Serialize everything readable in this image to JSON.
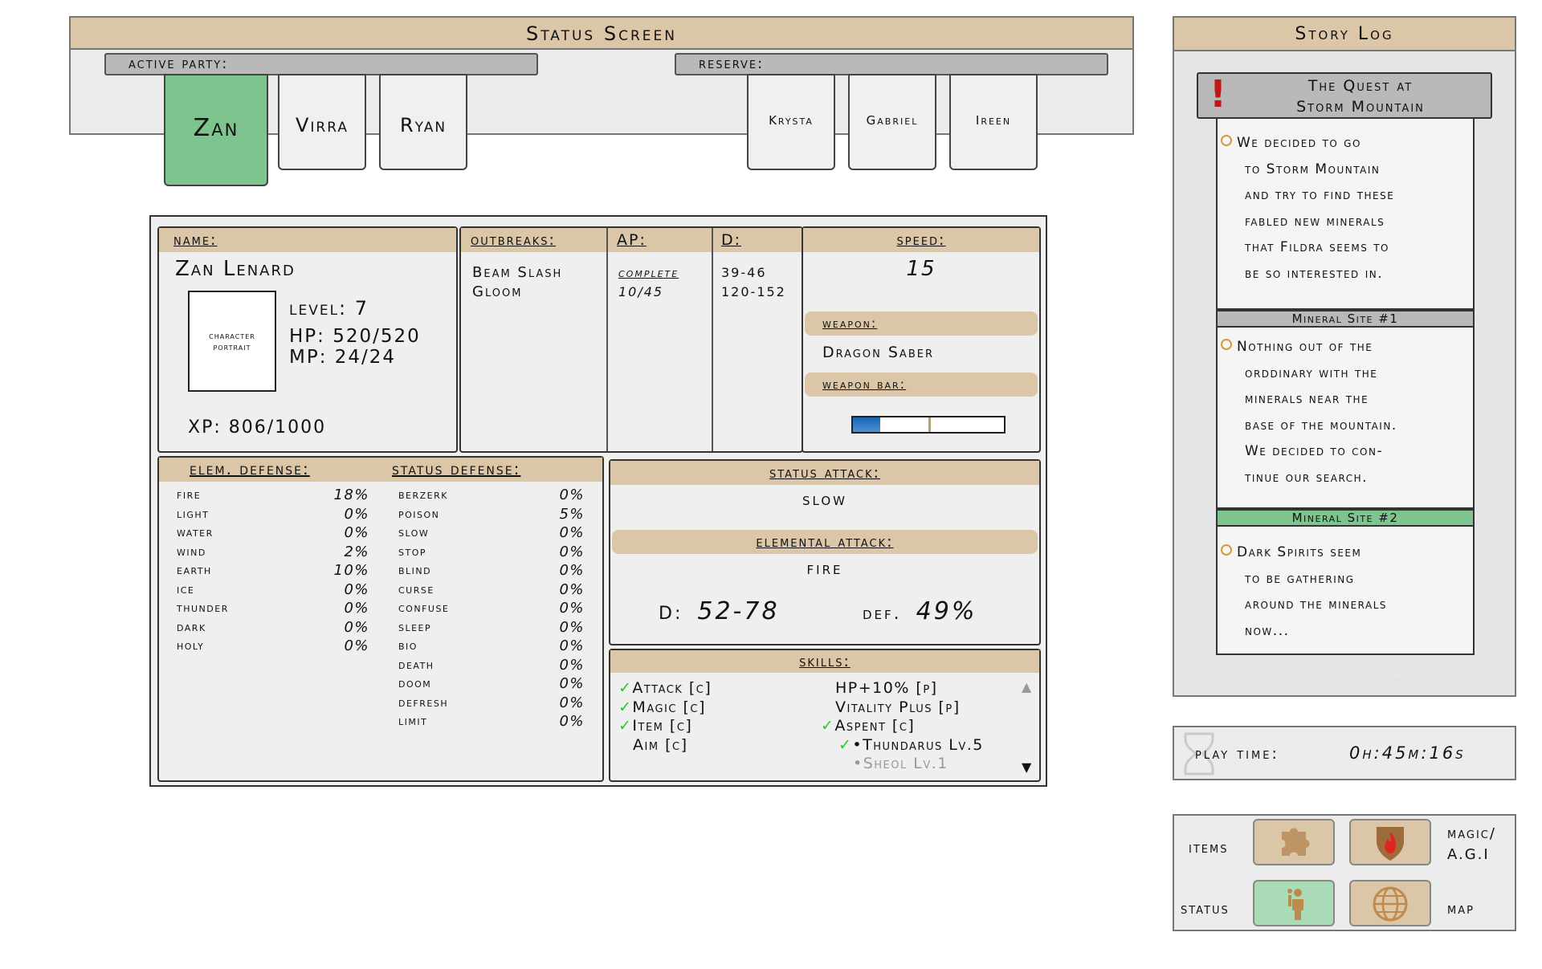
{
  "top": {
    "title": "Status Screen",
    "active_label": "active party:",
    "reserve_label": "reserve:",
    "active_party": [
      "Zan",
      "Virra",
      "Ryan"
    ],
    "reserve": [
      "Krysta",
      "Gabriel",
      "Ireen"
    ]
  },
  "character": {
    "name_label": "name:",
    "name": "Zan Lenard",
    "portrait_label": "character portrait",
    "level": "level: 7",
    "hp": "HP: 520/520",
    "mp": "MP: 24/24",
    "xp": "XP: 806/1000"
  },
  "outbreaks": {
    "label": "outbreaks:",
    "items": [
      "Beam Slash",
      "Gloom"
    ],
    "ap_label": "AP:",
    "ap_values": [
      "complete",
      "10/45"
    ],
    "d_label": "D:",
    "d_values": [
      "39-46",
      "120-152"
    ]
  },
  "speed": {
    "label": "speed:",
    "value": "15"
  },
  "weapon": {
    "label": "weapon:",
    "name": "Dragon Saber",
    "bar_label": "weapon bar:",
    "bar_fill": 0.18
  },
  "elem_defense": {
    "label": "elem. defense:",
    "rows": [
      {
        "name": "fire",
        "value": "18%"
      },
      {
        "name": "light",
        "value": "0%"
      },
      {
        "name": "water",
        "value": "0%"
      },
      {
        "name": "wind",
        "value": "2%"
      },
      {
        "name": "earth",
        "value": "10%"
      },
      {
        "name": "ice",
        "value": "0%"
      },
      {
        "name": "thunder",
        "value": "0%"
      },
      {
        "name": "dark",
        "value": "0%"
      },
      {
        "name": "holy",
        "value": "0%"
      }
    ]
  },
  "status_defense": {
    "label": "status defense:",
    "rows": [
      {
        "name": "berzerk",
        "value": "0%"
      },
      {
        "name": "poison",
        "value": "5%"
      },
      {
        "name": "slow",
        "value": "0%"
      },
      {
        "name": "stop",
        "value": "0%"
      },
      {
        "name": "blind",
        "value": "0%"
      },
      {
        "name": "curse",
        "value": "0%"
      },
      {
        "name": "confuse",
        "value": "0%"
      },
      {
        "name": "sleep",
        "value": "0%"
      },
      {
        "name": "bio",
        "value": "0%"
      },
      {
        "name": "death",
        "value": "0%"
      },
      {
        "name": "doom",
        "value": "0%"
      },
      {
        "name": "defresh",
        "value": "0%"
      },
      {
        "name": "limit",
        "value": "0%"
      }
    ]
  },
  "attack": {
    "status_label": "status attack:",
    "status_value": "slow",
    "elemental_label": "elemental attack:",
    "elemental_value": "fire",
    "d_label": "D:",
    "d_value": "52-78",
    "def_label": "def.",
    "def_value": "49%"
  },
  "skills": {
    "label": "skills:",
    "left": [
      "Attack [c]",
      "Magic [c]",
      "Item [c]",
      "Aim [c]"
    ],
    "right": [
      "HP+10% [p]",
      "Vitality Plus [p]",
      "Aspent [c]",
      "•Thundarus Lv.5",
      "•Sheol Lv.1"
    ]
  },
  "story": {
    "title": "Story Log",
    "quest": [
      "The Quest at",
      "Storm Mountain"
    ],
    "entry1": [
      "We decided to go",
      "to Storm Mountain",
      "and try to find these",
      "fabled new minerals",
      "that Fildra seems to",
      "be so interested in."
    ],
    "site1": "Mineral Site #1",
    "entry2": [
      "Nothing out of the",
      "orddinary with the",
      "minerals near the",
      "base of the mountain.",
      "We decided to con-",
      "tinue our search."
    ],
    "site2": "Mineral Site #2",
    "entry3": [
      "Dark Spirits seem",
      "to be gathering",
      "around the minerals",
      "now..."
    ]
  },
  "playtime": {
    "label": "play time:",
    "value": "0h:45m:16s"
  },
  "menu": {
    "items": "items",
    "magic1": "magic/",
    "magic2": "A.G.I",
    "status": "status",
    "map": "map"
  },
  "colors": {
    "tan": "#dcc6a8",
    "active_green": "#7dc48e",
    "site2_green": "#7dc48e",
    "bar_blue": "#1a64b4"
  }
}
